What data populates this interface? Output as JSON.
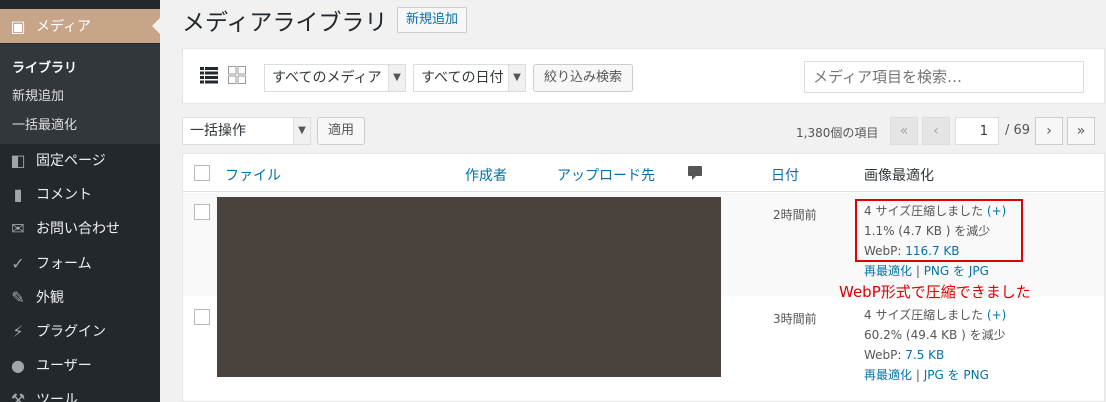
{
  "sidebar": {
    "current": {
      "label": "メディア",
      "icon": "media-icon"
    },
    "submenu": [
      "ライブラリ",
      "新規追加",
      "一括最適化"
    ],
    "items": [
      {
        "label": "固定ページ",
        "icon": "page-icon"
      },
      {
        "label": "コメント",
        "icon": "comment-icon"
      },
      {
        "label": "お問い合わせ",
        "icon": "mail-icon"
      },
      {
        "label": "フォーム",
        "icon": "check-icon"
      },
      {
        "label": "外観",
        "icon": "brush-icon"
      },
      {
        "label": "プラグイン",
        "icon": "plugin-icon"
      },
      {
        "label": "ユーザー",
        "icon": "user-icon"
      },
      {
        "label": "ツール",
        "icon": "wrench-icon"
      }
    ]
  },
  "header": {
    "title": "メディアライブラリ",
    "add_new": "新規追加"
  },
  "filters": {
    "media_type": "すべてのメディア",
    "date": "すべての日付",
    "filter_button": "絞り込み検索",
    "search_placeholder": "メディア項目を検索…"
  },
  "tablenav": {
    "bulk_action": "一括操作",
    "apply": "適用",
    "items_count": "1,380個の項目",
    "first": "«",
    "prev": "‹",
    "current_page": "1",
    "total_pages": "/ 69",
    "next": "›",
    "last": "»"
  },
  "table": {
    "columns": {
      "file": "ファイル",
      "author": "作成者",
      "uploaded_to": "アップロード先",
      "date": "日付",
      "optimize": "画像最適化"
    },
    "rows": [
      {
        "date": "2時間前",
        "compressed": "4 サイズ圧縮しました",
        "plus": "(+)",
        "reduced": "1.1% (4.7 KB ) を減少",
        "webp_label": "WebP: ",
        "webp_size": "116.7 KB",
        "reoptimize": "再最適化",
        "sep": " | ",
        "convert": "PNG を JPG"
      },
      {
        "date": "3時間前",
        "compressed": "4 サイズ圧縮しました",
        "plus": "(+)",
        "reduced": "60.2% (49.4 KB ) を減少",
        "webp_label": "WebP: ",
        "webp_size": "7.5 KB",
        "reoptimize": "再最適化",
        "sep": " | ",
        "convert": "JPG を PNG"
      }
    ]
  },
  "annotation": "WebP形式で圧縮できました",
  "colors": {
    "sidebar_bg": "#23282d",
    "current_menu": "#c7a589",
    "link": "#0073aa",
    "annotation": "#e00000",
    "thumbnail": "#4a423c"
  }
}
